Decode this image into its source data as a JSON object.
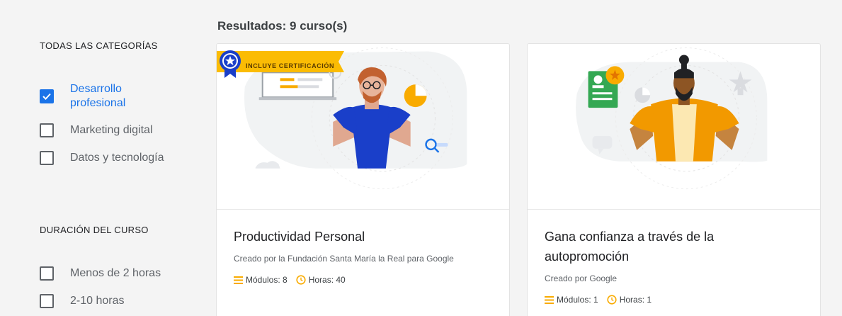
{
  "sidebar": {
    "categories_title": "TODAS LAS CATEGORÍAS",
    "categories": [
      {
        "label": "Desarrollo profesional",
        "checked": true
      },
      {
        "label": "Marketing digital",
        "checked": false
      },
      {
        "label": "Datos y tecnología",
        "checked": false
      }
    ],
    "duration_title": "DURACIÓN DEL CURSO",
    "durations": [
      {
        "label": "Menos de 2 horas",
        "checked": false
      },
      {
        "label": "2-10 horas",
        "checked": false
      }
    ]
  },
  "results": {
    "label": "Resultados: 9 curso(s)"
  },
  "courses": [
    {
      "badge": "INCLUYE CERTIFICACIÓN",
      "title": "Productividad Personal",
      "creator": "Creado por la Fundación Santa María la Real para Google",
      "modules": "Módulos: 8",
      "hours": "Horas: 40"
    },
    {
      "title": "Gana confianza a través de la autopromoción",
      "creator": "Creado por Google",
      "modules": "Módulos: 1",
      "hours": "Horas: 1"
    }
  ],
  "colors": {
    "accent": "#1a73e8",
    "badge": "#fbbc04",
    "icon_yellow": "#f9ab00"
  },
  "icons": [
    "checkbox-checked-icon",
    "checkbox-icon",
    "certification-medal-icon",
    "modules-list-icon",
    "clock-icon"
  ]
}
